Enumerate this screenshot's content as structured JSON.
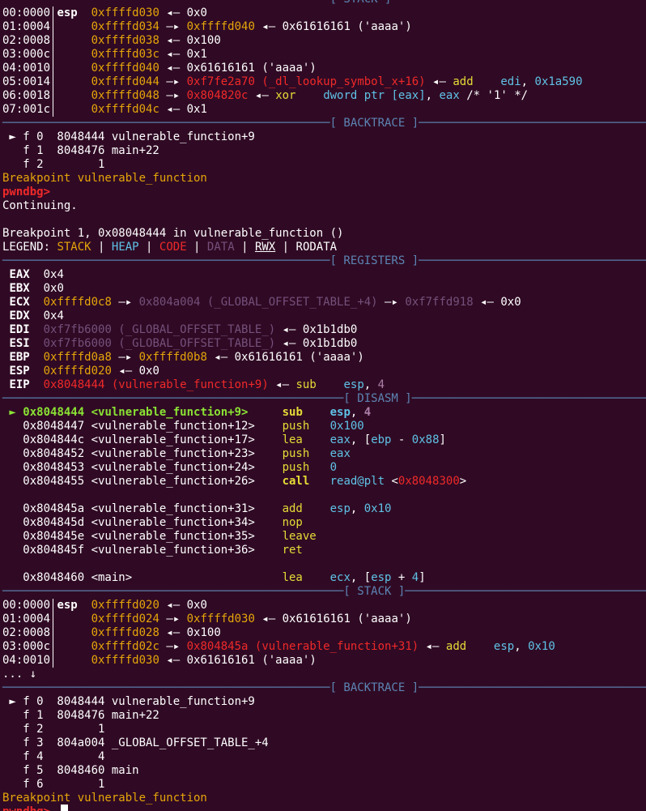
{
  "colors": {
    "background": "#300a24",
    "text": "#ffffff",
    "separator": "#5c84b3",
    "stack": "#e5a50a",
    "code": "#ef2929",
    "heap": "#75507b",
    "current_instruction": "#8ae234",
    "mnemonic": "#e6db37",
    "operand": "#5fc2e6"
  },
  "terminal": {
    "lines": [
      {
        "kind": "sep",
        "spans": [
          {
            "t": "────────────────────────────────────────────────[ STACK ]───────────────────────────────────────────────"
          }
        ]
      },
      {
        "kind": "bar",
        "spans": [
          {
            "t": "00:0000"
          },
          {
            "t": " "
          },
          {
            "t": "esp",
            "c": "b"
          },
          {
            "t": "  "
          },
          {
            "t": "0xffffd030",
            "c": "y"
          },
          {
            "t": " ◂— 0x0"
          }
        ]
      },
      {
        "kind": "bar",
        "spans": [
          {
            "t": "01:0004"
          },
          {
            "t": "      "
          },
          {
            "t": "0xffffd034",
            "c": "y"
          },
          {
            "t": " —▸ "
          },
          {
            "t": "0xffffd040",
            "c": "y"
          },
          {
            "t": " ◂— 0x61616161 ('aaaa')"
          }
        ]
      },
      {
        "kind": "bar",
        "spans": [
          {
            "t": "02:0008"
          },
          {
            "t": "      "
          },
          {
            "t": "0xffffd038",
            "c": "y"
          },
          {
            "t": " ◂— 0x100"
          }
        ]
      },
      {
        "kind": "bar",
        "spans": [
          {
            "t": "03:000c"
          },
          {
            "t": "      "
          },
          {
            "t": "0xffffd03c",
            "c": "y"
          },
          {
            "t": " ◂— 0x1"
          }
        ]
      },
      {
        "kind": "bar",
        "spans": [
          {
            "t": "04:0010"
          },
          {
            "t": "      "
          },
          {
            "t": "0xffffd040",
            "c": "y"
          },
          {
            "t": " ◂— 0x61616161 ('aaaa')"
          }
        ]
      },
      {
        "kind": "bar",
        "spans": [
          {
            "t": "05:0014"
          },
          {
            "t": "      "
          },
          {
            "t": "0xffffd044",
            "c": "y"
          },
          {
            "t": " —▸ "
          },
          {
            "t": "0xf7fe2a70 (_dl_lookup_symbol_x+16)",
            "c": "r"
          },
          {
            "t": " ◂— "
          },
          {
            "t": "add",
            "c": "yb"
          },
          {
            "t": "    "
          },
          {
            "t": "edi",
            "c": "cy"
          },
          {
            "t": ", "
          },
          {
            "t": "0x1a590",
            "c": "cy"
          }
        ]
      },
      {
        "kind": "bar",
        "spans": [
          {
            "t": "06:0018"
          },
          {
            "t": "      "
          },
          {
            "t": "0xffffd048",
            "c": "y"
          },
          {
            "t": " —▸ "
          },
          {
            "t": "0x804820c",
            "c": "r"
          },
          {
            "t": " ◂— "
          },
          {
            "t": "xor",
            "c": "yb"
          },
          {
            "t": "    "
          },
          {
            "t": "dword ptr [eax]",
            "c": "cy"
          },
          {
            "t": ", "
          },
          {
            "t": "eax",
            "c": "cy"
          },
          {
            "t": " /* '1' */"
          }
        ]
      },
      {
        "kind": "bar",
        "spans": [
          {
            "t": "07:001c"
          },
          {
            "t": "      "
          },
          {
            "t": "0xffffd04c",
            "c": "y"
          },
          {
            "t": " ◂— 0x1"
          }
        ]
      },
      {
        "kind": "sep",
        "spans": [
          {
            "t": "────────────────────────────────────────────────[ BACKTRACE ]───────────────────────────────────────────"
          }
        ]
      },
      {
        "kind": "text",
        "spans": [
          {
            "t": " ► f 0  8048444 vulnerable_function+9"
          }
        ]
      },
      {
        "kind": "text",
        "spans": [
          {
            "t": "   f 1  8048476 main+22"
          }
        ]
      },
      {
        "kind": "text",
        "spans": [
          {
            "t": "   f 2        1"
          }
        ]
      },
      {
        "kind": "text",
        "spans": [
          {
            "t": "Breakpoint vulnerable_function",
            "c": "y"
          }
        ]
      },
      {
        "kind": "text",
        "spans": [
          {
            "t": "pwndbg>",
            "c": "r b"
          }
        ]
      },
      {
        "kind": "text",
        "spans": [
          {
            "t": "Continuing."
          }
        ]
      },
      {
        "kind": "text",
        "spans": [
          {
            "t": ""
          }
        ]
      },
      {
        "kind": "text",
        "spans": [
          {
            "t": "Breakpoint 1, 0x08048444 in vulnerable_function ()"
          }
        ]
      },
      {
        "kind": "text",
        "spans": [
          {
            "t": "LEGEND: "
          },
          {
            "t": "STACK",
            "c": "y"
          },
          {
            "t": " | "
          },
          {
            "t": "HEAP",
            "c": "cy"
          },
          {
            "t": " | "
          },
          {
            "t": "CODE",
            "c": "r"
          },
          {
            "t": " | "
          },
          {
            "t": "DATA",
            "c": "db"
          },
          {
            "t": " | "
          },
          {
            "t": "RWX",
            "c": "u"
          },
          {
            "t": " | RODATA"
          }
        ]
      },
      {
        "kind": "sep",
        "spans": [
          {
            "t": "────────────────────────────────────────────────[ REGISTERS ]───────────────────────────────────────────"
          }
        ]
      },
      {
        "kind": "text",
        "spans": [
          {
            "t": " "
          },
          {
            "t": "EAX",
            "c": "b"
          },
          {
            "t": "  0x4"
          }
        ]
      },
      {
        "kind": "text",
        "spans": [
          {
            "t": " "
          },
          {
            "t": "EBX",
            "c": "b"
          },
          {
            "t": "  0x0"
          }
        ]
      },
      {
        "kind": "text",
        "spans": [
          {
            "t": " "
          },
          {
            "t": "ECX",
            "c": "b"
          },
          {
            "t": "  "
          },
          {
            "t": "0xffffd0c8",
            "c": "y"
          },
          {
            "t": " —▸ "
          },
          {
            "t": "0x804a004 (_GLOBAL_OFFSET_TABLE_+4)",
            "c": "db"
          },
          {
            "t": " —▸ "
          },
          {
            "t": "0xf7ffd918",
            "c": "db"
          },
          {
            "t": " ◂— 0x0"
          }
        ]
      },
      {
        "kind": "text",
        "spans": [
          {
            "t": " "
          },
          {
            "t": "EDX",
            "c": "b"
          },
          {
            "t": "  0x4"
          }
        ]
      },
      {
        "kind": "text",
        "spans": [
          {
            "t": " "
          },
          {
            "t": "EDI",
            "c": "b"
          },
          {
            "t": "  "
          },
          {
            "t": "0xf7fb6000 (_GLOBAL_OFFSET_TABLE_)",
            "c": "db"
          },
          {
            "t": " ◂— 0x1b1db0"
          }
        ]
      },
      {
        "kind": "text",
        "spans": [
          {
            "t": " "
          },
          {
            "t": "ESI",
            "c": "b"
          },
          {
            "t": "  "
          },
          {
            "t": "0xf7fb6000 (_GLOBAL_OFFSET_TABLE_)",
            "c": "db"
          },
          {
            "t": " ◂— 0x1b1db0"
          }
        ]
      },
      {
        "kind": "text",
        "spans": [
          {
            "t": " "
          },
          {
            "t": "EBP",
            "c": "b"
          },
          {
            "t": "  "
          },
          {
            "t": "0xffffd0a8",
            "c": "y"
          },
          {
            "t": " —▸ "
          },
          {
            "t": "0xffffd0b8",
            "c": "y"
          },
          {
            "t": " ◂— 0x61616161 ('aaaa')"
          }
        ]
      },
      {
        "kind": "text",
        "spans": [
          {
            "t": " "
          },
          {
            "t": "ESP",
            "c": "b"
          },
          {
            "t": "  "
          },
          {
            "t": "0xffffd020",
            "c": "y"
          },
          {
            "t": " ◂— 0x0"
          }
        ]
      },
      {
        "kind": "text",
        "spans": [
          {
            "t": " "
          },
          {
            "t": "EIP",
            "c": "b"
          },
          {
            "t": "  "
          },
          {
            "t": "0x8048444 (vulnerable_function+9)",
            "c": "r"
          },
          {
            "t": " ◂— "
          },
          {
            "t": "sub",
            "c": "yb"
          },
          {
            "t": "    "
          },
          {
            "t": "esp",
            "c": "cy"
          },
          {
            "t": ", "
          },
          {
            "t": "4",
            "c": "p"
          }
        ]
      },
      {
        "kind": "sep",
        "spans": [
          {
            "t": "──────────────────────────────────────────────────[ DISASM ]────────────────────────────────────────────"
          }
        ]
      },
      {
        "kind": "text",
        "spans": [
          {
            "t": " ► ",
            "c": "bg"
          },
          {
            "t": "0x8048444 <vulnerable_function+9>",
            "c": "bg"
          },
          {
            "t": "     "
          },
          {
            "t": "sub",
            "c": "yb b"
          },
          {
            "t": "    "
          },
          {
            "t": "esp",
            "c": "cy b"
          },
          {
            "t": ", "
          },
          {
            "t": "4",
            "c": "p b"
          }
        ]
      },
      {
        "kind": "text",
        "spans": [
          {
            "t": "   0x8048447 <vulnerable_function+12>    "
          },
          {
            "t": "push",
            "c": "yb"
          },
          {
            "t": "   "
          },
          {
            "t": "0x100",
            "c": "cy"
          }
        ]
      },
      {
        "kind": "text",
        "spans": [
          {
            "t": "   0x804844c <vulnerable_function+17>    "
          },
          {
            "t": "lea",
            "c": "yb"
          },
          {
            "t": "    "
          },
          {
            "t": "eax",
            "c": "cy"
          },
          {
            "t": ", ["
          },
          {
            "t": "ebp",
            "c": "cy"
          },
          {
            "t": " - "
          },
          {
            "t": "0x88",
            "c": "cy"
          },
          {
            "t": "]"
          }
        ]
      },
      {
        "kind": "text",
        "spans": [
          {
            "t": "   0x8048452 <vulnerable_function+23>    "
          },
          {
            "t": "push",
            "c": "yb"
          },
          {
            "t": "   "
          },
          {
            "t": "eax",
            "c": "cy"
          }
        ]
      },
      {
        "kind": "text",
        "spans": [
          {
            "t": "   0x8048453 <vulnerable_function+24>    "
          },
          {
            "t": "push",
            "c": "yb"
          },
          {
            "t": "   "
          },
          {
            "t": "0",
            "c": "cy"
          }
        ]
      },
      {
        "kind": "text",
        "spans": [
          {
            "t": "   0x8048455 <vulnerable_function+26>    "
          },
          {
            "t": "call",
            "c": "yb b"
          },
          {
            "t": "   "
          },
          {
            "t": "read@plt",
            "c": "cy"
          },
          {
            "t": " <"
          },
          {
            "t": "0x8048300",
            "c": "r"
          },
          {
            "t": ">"
          }
        ]
      },
      {
        "kind": "text",
        "spans": [
          {
            "t": ""
          }
        ]
      },
      {
        "kind": "text",
        "spans": [
          {
            "t": "   0x804845a <vulnerable_function+31>    "
          },
          {
            "t": "add",
            "c": "yb"
          },
          {
            "t": "    "
          },
          {
            "t": "esp",
            "c": "cy"
          },
          {
            "t": ", "
          },
          {
            "t": "0x10",
            "c": "cy"
          }
        ]
      },
      {
        "kind": "text",
        "spans": [
          {
            "t": "   0x804845d <vulnerable_function+34>    "
          },
          {
            "t": "nop",
            "c": "yb"
          }
        ]
      },
      {
        "kind": "text",
        "spans": [
          {
            "t": "   0x804845e <vulnerable_function+35>    "
          },
          {
            "t": "leave",
            "c": "yb"
          }
        ]
      },
      {
        "kind": "text",
        "spans": [
          {
            "t": "   0x804845f <vulnerable_function+36>    "
          },
          {
            "t": "ret",
            "c": "yb"
          }
        ]
      },
      {
        "kind": "text",
        "spans": [
          {
            "t": ""
          }
        ]
      },
      {
        "kind": "text",
        "spans": [
          {
            "t": "   0x8048460 <main>                      "
          },
          {
            "t": "lea",
            "c": "yb"
          },
          {
            "t": "    "
          },
          {
            "t": "ecx",
            "c": "cy"
          },
          {
            "t": ", ["
          },
          {
            "t": "esp",
            "c": "cy"
          },
          {
            "t": " + "
          },
          {
            "t": "4",
            "c": "cy"
          },
          {
            "t": "]"
          }
        ]
      },
      {
        "kind": "sep",
        "spans": [
          {
            "t": "──────────────────────────────────────────────────[ STACK ]─────────────────────────────────────────────"
          }
        ]
      },
      {
        "kind": "bar",
        "spans": [
          {
            "t": "00:0000"
          },
          {
            "t": " "
          },
          {
            "t": "esp",
            "c": "b"
          },
          {
            "t": "  "
          },
          {
            "t": "0xffffd020",
            "c": "y"
          },
          {
            "t": " ◂— 0x0"
          }
        ]
      },
      {
        "kind": "bar",
        "spans": [
          {
            "t": "01:0004"
          },
          {
            "t": "      "
          },
          {
            "t": "0xffffd024",
            "c": "y"
          },
          {
            "t": " —▸ "
          },
          {
            "t": "0xffffd030",
            "c": "y"
          },
          {
            "t": " ◂— 0x61616161 ('aaaa')"
          }
        ]
      },
      {
        "kind": "bar",
        "spans": [
          {
            "t": "02:0008"
          },
          {
            "t": "      "
          },
          {
            "t": "0xffffd028",
            "c": "y"
          },
          {
            "t": " ◂— 0x100"
          }
        ]
      },
      {
        "kind": "bar",
        "spans": [
          {
            "t": "03:000c"
          },
          {
            "t": "      "
          },
          {
            "t": "0xffffd02c",
            "c": "y"
          },
          {
            "t": " —▸ "
          },
          {
            "t": "0x804845a (vulnerable_function+31)",
            "c": "r"
          },
          {
            "t": " ◂— "
          },
          {
            "t": "add",
            "c": "yb"
          },
          {
            "t": "    "
          },
          {
            "t": "esp",
            "c": "cy"
          },
          {
            "t": ", "
          },
          {
            "t": "0x10",
            "c": "cy"
          }
        ]
      },
      {
        "kind": "bar",
        "spans": [
          {
            "t": "04:0010"
          },
          {
            "t": "      "
          },
          {
            "t": "0xffffd030",
            "c": "y"
          },
          {
            "t": " ◂— 0x61616161 ('aaaa')"
          }
        ]
      },
      {
        "kind": "text",
        "spans": [
          {
            "t": "... ↓"
          }
        ]
      },
      {
        "kind": "sep",
        "spans": [
          {
            "t": "────────────────────────────────────────────────[ BACKTRACE ]───────────────────────────────────────────"
          }
        ]
      },
      {
        "kind": "text",
        "spans": [
          {
            "t": " ► f 0  8048444 vulnerable_function+9"
          }
        ]
      },
      {
        "kind": "text",
        "spans": [
          {
            "t": "   f 1  8048476 main+22"
          }
        ]
      },
      {
        "kind": "text",
        "spans": [
          {
            "t": "   f 2        1"
          }
        ]
      },
      {
        "kind": "text",
        "spans": [
          {
            "t": "   f 3  804a004 _GLOBAL_OFFSET_TABLE_+4"
          }
        ]
      },
      {
        "kind": "text",
        "spans": [
          {
            "t": "   f 4        4"
          }
        ]
      },
      {
        "kind": "text",
        "spans": [
          {
            "t": "   f 5  8048460 main"
          }
        ]
      },
      {
        "kind": "text",
        "spans": [
          {
            "t": "   f 6        1"
          }
        ]
      },
      {
        "kind": "text",
        "spans": [
          {
            "t": "Breakpoint vulnerable_function",
            "c": "y"
          }
        ]
      },
      {
        "kind": "prompt",
        "spans": [
          {
            "t": "pwndbg>",
            "c": "r b"
          },
          {
            "t": " "
          }
        ]
      }
    ]
  }
}
